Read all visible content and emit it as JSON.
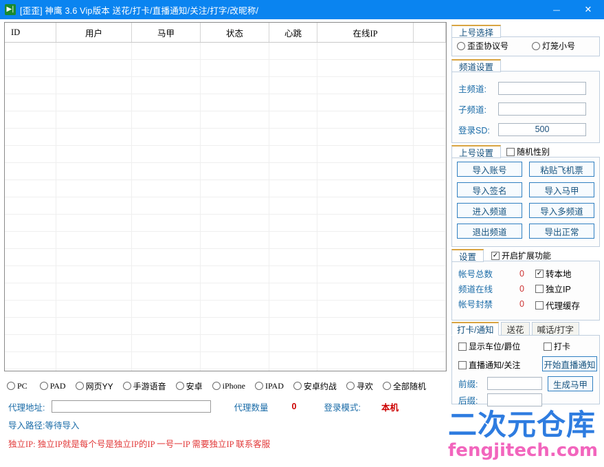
{
  "window": {
    "title": "[歪歪] 神鹰 3.6 Vip版本 送花/打卡/直播通知/关注/打字/改昵称/",
    "icon": "media-play-icon",
    "minimize_label": "—",
    "close_label": "✕",
    "titlebar_color": "#0a84f0"
  },
  "grid": {
    "columns": [
      "ID",
      "用户",
      "马甲",
      "状态",
      "心跳",
      "在线IP",
      ""
    ],
    "rows": []
  },
  "client_types": {
    "options": [
      {
        "label": "PC",
        "ascii": true,
        "selected": false
      },
      {
        "label": "PAD",
        "ascii": true,
        "selected": false
      },
      {
        "label": "网页YY",
        "ascii": false,
        "selected": false
      },
      {
        "label": "手游语音",
        "ascii": false,
        "selected": false
      },
      {
        "label": "安卓",
        "ascii": false,
        "selected": false
      },
      {
        "label": "iPhone",
        "ascii": true,
        "selected": false
      },
      {
        "label": "IPAD",
        "ascii": true,
        "selected": false
      },
      {
        "label": "安卓约战",
        "ascii": false,
        "selected": false
      },
      {
        "label": "寻欢",
        "ascii": false,
        "selected": false
      },
      {
        "label": "全部随机",
        "ascii": false,
        "selected": false
      }
    ]
  },
  "proxy": {
    "address_label": "代理地址:",
    "address_value": "",
    "address_placeholder": "",
    "count_label": "代理数量",
    "count_value": "0",
    "login_mode_label": "登录模式:",
    "login_mode_value": "本机"
  },
  "import_path": "导入路径:等待导入",
  "ip_notice": "独立IP: 独立IP就是每个号是独立IP的IP 一号一IP 需要独立IP 联系客服",
  "panel_login_select": {
    "title": "上号选择",
    "options": [
      {
        "label": "歪歪协议号",
        "selected": false
      },
      {
        "label": "灯笼小号",
        "selected": false
      }
    ]
  },
  "panel_channel": {
    "title": "频道设置",
    "fields": [
      {
        "label": "主频道:",
        "value": ""
      },
      {
        "label": "子频道:",
        "value": ""
      },
      {
        "label": "登录SD:",
        "value": "500"
      }
    ]
  },
  "panel_setup": {
    "title": "上号设置",
    "random_gender": {
      "label": "随机性别",
      "checked": false
    },
    "buttons": [
      "导入账号",
      "粘贴飞机票",
      "导入签名",
      "导入马甲",
      "进入频道",
      "导入多频道",
      "退出频道",
      "导出正常"
    ]
  },
  "panel_settings": {
    "title": "设置",
    "extension": {
      "label": "开启扩展功能",
      "checked": true
    },
    "stats": [
      {
        "label": "帐号总数",
        "value": "0"
      },
      {
        "label": "频道在线",
        "value": "0"
      },
      {
        "label": "帐号封禁",
        "value": "0"
      }
    ],
    "checks": [
      {
        "label": "转本地",
        "checked": true
      },
      {
        "label": "独立IP",
        "checked": false
      },
      {
        "label": "代理缓存",
        "checked": false
      }
    ]
  },
  "panel_tabs": {
    "tabs": [
      {
        "label": "打卡/通知",
        "active": true
      },
      {
        "label": "送花",
        "active": false
      },
      {
        "label": "喊话/打字",
        "active": false
      }
    ],
    "checks": [
      {
        "label": "显示车位/爵位",
        "checked": false
      },
      {
        "label": "直播通知/关注",
        "checked": false
      },
      {
        "label": "打卡",
        "checked": false
      }
    ],
    "buttons": [
      {
        "label": "开始直播通知"
      },
      {
        "label": "生成马甲"
      }
    ],
    "fields": [
      {
        "label": "前缀:",
        "value": ""
      },
      {
        "label": "后缀:",
        "value": ""
      }
    ]
  },
  "watermark": {
    "cn": "二次元仓库",
    "en": "fengjitech.com",
    "cn_color": "#2e7ce0",
    "en_color": "#f265bd"
  }
}
